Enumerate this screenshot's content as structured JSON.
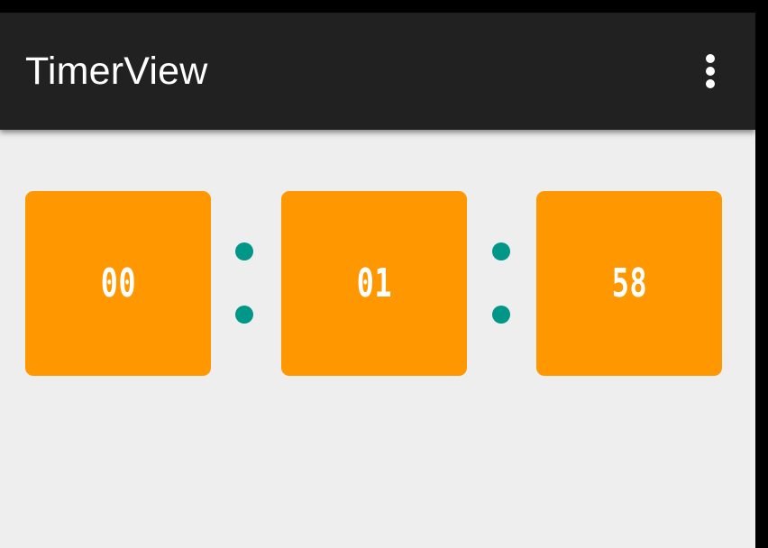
{
  "app_bar": {
    "title": "TimerView",
    "overflow_icon": "more-vert-icon",
    "background_color": "#212121"
  },
  "timer": {
    "hours": "00",
    "minutes": "01",
    "seconds": "58",
    "separator": ":",
    "tile_color": "#ff9800",
    "separator_color": "#009688"
  },
  "content_background": "#eeeeee"
}
